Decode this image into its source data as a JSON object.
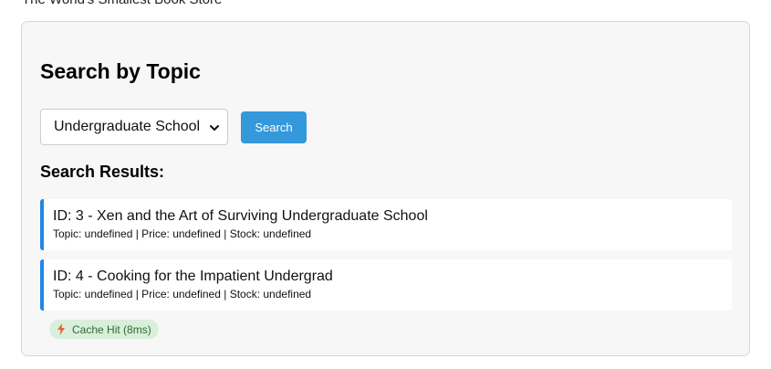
{
  "header": {
    "site_title": "The World's Smallest Book Store"
  },
  "search": {
    "title": "Search by Topic",
    "selected_topic": "Undergraduate School",
    "button_label": "Search"
  },
  "results": {
    "heading": "Search Results:",
    "items": [
      {
        "title": "ID: 3 - Xen and the Art of Surviving Undergraduate School",
        "meta": "Topic: undefined | Price: undefined | Stock: undefined"
      },
      {
        "title": "ID: 4 - Cooking for the Impatient Undergrad",
        "meta": "Topic: undefined | Price: undefined | Stock: undefined"
      }
    ]
  },
  "status": {
    "cache_label": "Cache Hit (8ms)",
    "icon": "lightning-bolt-icon"
  },
  "colors": {
    "accent": "#3498db",
    "card_border": "#1e88e5",
    "badge_bg": "#d9eedb",
    "badge_text": "#2e6b33",
    "bolt": "#e8622c"
  }
}
